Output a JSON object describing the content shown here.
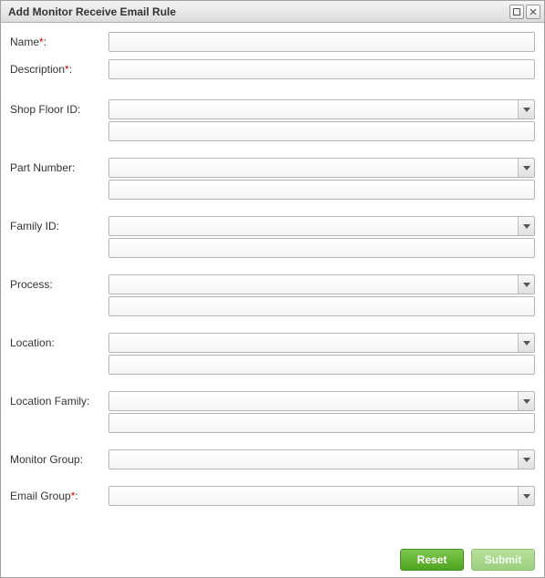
{
  "window": {
    "title": "Add Monitor Receive Email Rule"
  },
  "labels": {
    "name": "Name",
    "description": "Description",
    "shopFloorId": "Shop Floor ID:",
    "partNumber": "Part Number:",
    "familyId": "Family ID:",
    "process": "Process:",
    "location": "Location:",
    "locationFamily": "Location Family:",
    "monitorGroup": "Monitor Group:",
    "emailGroup": "Email Group",
    "colon": ":",
    "required": "*"
  },
  "values": {
    "name": "",
    "description": "",
    "shopFloorId": "",
    "shopFloorId_extra": "",
    "partNumber": "",
    "partNumber_extra": "",
    "familyId": "",
    "familyId_extra": "",
    "process": "",
    "process_extra": "",
    "location": "",
    "location_extra": "",
    "locationFamily": "",
    "locationFamily_extra": "",
    "monitorGroup": "",
    "emailGroup": ""
  },
  "buttons": {
    "reset": "Reset",
    "submit": "Submit"
  },
  "colors": {
    "accent": "#5aaa2a",
    "required": "#cc0000"
  }
}
